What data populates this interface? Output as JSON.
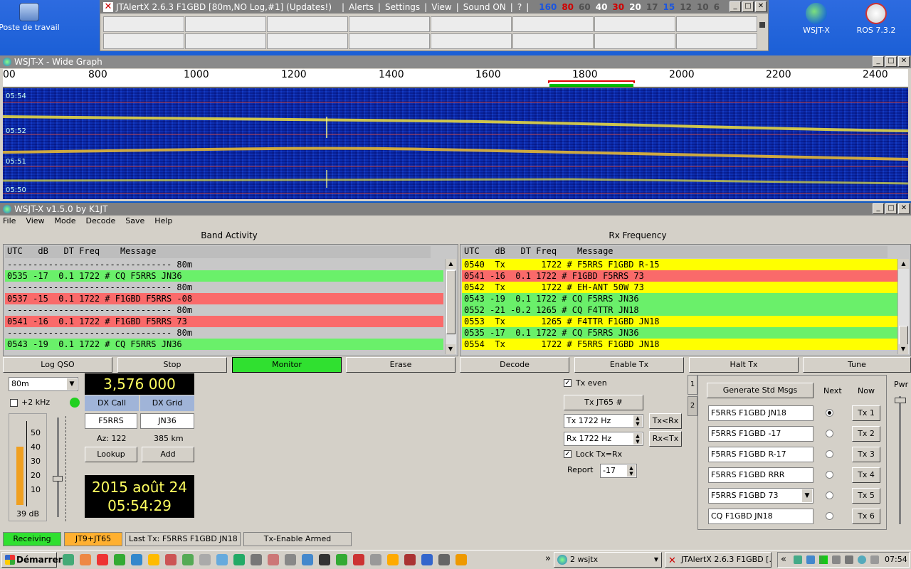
{
  "desktop": {
    "icons": [
      {
        "label": "Poste de travail"
      },
      {
        "label": "WSJT-X"
      },
      {
        "label": "ROS 7.3.2"
      }
    ]
  },
  "jtalert": {
    "title": "JTAlertX 2.6.3 F1GBD [80m,NO Log,#1] (Updates!)",
    "menu": [
      "Alerts",
      "Settings",
      "View",
      "Sound ON",
      "?"
    ],
    "bands": [
      {
        "label": "160",
        "color": "#1a55e0"
      },
      {
        "label": "80",
        "color": "#d00000"
      },
      {
        "label": "60",
        "color": "#505050"
      },
      {
        "label": "40",
        "color": "#ffffff"
      },
      {
        "label": "30",
        "color": "#d00000"
      },
      {
        "label": "20",
        "color": "#ffffff"
      },
      {
        "label": "17",
        "color": "#505050"
      },
      {
        "label": "15",
        "color": "#1a55e0"
      },
      {
        "label": "12",
        "color": "#505050"
      },
      {
        "label": "10",
        "color": "#505050"
      },
      {
        "label": "6",
        "color": "#505050"
      }
    ]
  },
  "wide_graph": {
    "title": "WSJT-X - Wide Graph",
    "scale_labels": [
      "00",
      "800",
      "1000",
      "1200",
      "1400",
      "1600",
      "1800",
      "2000",
      "2200",
      "2400"
    ],
    "time_labels": [
      "05:54",
      "05:52",
      "05:51",
      "05:50"
    ]
  },
  "main": {
    "title": "WSJT-X  v1.5.0  by K1JT",
    "menu": [
      "File",
      "View",
      "Mode",
      "Decode",
      "Save",
      "Help"
    ],
    "band_activity": {
      "header": "Band Activity",
      "columns": "UTC   dB   DT Freq    Message",
      "rows": [
        {
          "text": "-------------------------------- 80m",
          "color": "#c8c8c8"
        },
        {
          "text": "0535 -17  0.1 1722 # CQ F5RRS JN36",
          "color": "#6af06a"
        },
        {
          "text": "-------------------------------- 80m",
          "color": "#c8c8c8"
        },
        {
          "text": "0537 -15  0.1 1722 # F1GBD F5RRS -08",
          "color": "#fa6a6a"
        },
        {
          "text": "-------------------------------- 80m",
          "color": "#c8c8c8"
        },
        {
          "text": "0541 -16  0.1 1722 # F1GBD F5RRS 73",
          "color": "#fa6a6a"
        },
        {
          "text": "-------------------------------- 80m",
          "color": "#c8c8c8"
        },
        {
          "text": "0543 -19  0.1 1722 # CQ F5RRS JN36",
          "color": "#6af06a"
        }
      ]
    },
    "rx_frequency": {
      "header": "Rx Frequency",
      "columns": "UTC   dB   DT Freq    Message",
      "rows": [
        {
          "text": "0540  Tx       1722 # F5RRS F1GBD R-15",
          "color": "#ffff00"
        },
        {
          "text": "0541 -16  0.1 1722 # F1GBD F5RRS 73",
          "color": "#fa6a6a"
        },
        {
          "text": "0542  Tx       1722 # EH-ANT 50W 73",
          "color": "#ffff00"
        },
        {
          "text": "0543 -19  0.1 1722 # CQ F5RRS JN36",
          "color": "#6af06a"
        },
        {
          "text": "0552 -21 -0.2 1265 # CQ F4TTR JN18",
          "color": "#6af06a"
        },
        {
          "text": "0553  Tx       1265 # F4TTR F1GBD JN18",
          "color": "#ffff00"
        },
        {
          "text": "0535 -17  0.1 1722 # CQ F5RRS JN36",
          "color": "#6af06a"
        },
        {
          "text": "0554  Tx       1722 # F5RRS F1GBD JN18",
          "color": "#ffff00"
        }
      ]
    },
    "buttons": {
      "log_qso": "Log QSO",
      "stop": "Stop",
      "monitor": "Monitor",
      "erase": "Erase",
      "decode": "Decode",
      "enable_tx": "Enable Tx",
      "halt_tx": "Halt Tx",
      "tune": "Tune"
    },
    "band_select": "80m",
    "plus2khz": "+2 kHz",
    "frequency": "3,576 000",
    "dx_call_label": "DX Call",
    "dx_grid_label": "DX Grid",
    "dx_call": "F5RRS",
    "dx_grid": "JN36",
    "azimuth": "Az: 122",
    "distance": "385 km",
    "lookup": "Lookup",
    "add": "Add",
    "meter_labels": [
      "50",
      "40",
      "30",
      "20",
      "10"
    ],
    "meter_level": 39,
    "meter_readout": "39  dB",
    "date": "2015 août 24",
    "time": "05:54:29",
    "tx_even": "Tx even",
    "tx_mode": "Tx JT65  #",
    "tx_freq": "Tx  1722  Hz",
    "rx_freq": "Rx  1722  Hz",
    "tx_lt_rx": "Tx<Rx",
    "rx_lt_tx": "Rx<Tx",
    "lock": "Lock Tx=Rx",
    "report_label": "Report",
    "report": "-17",
    "tab1": "1",
    "tab2": "2",
    "gen_msgs": "Generate Std Msgs",
    "next_label": "Next",
    "now_label": "Now",
    "pwr_label": "Pwr",
    "messages": [
      {
        "text": "F5RRS F1GBD JN18",
        "btn": "Tx 1"
      },
      {
        "text": "F5RRS F1GBD -17",
        "btn": "Tx 2"
      },
      {
        "text": "F5RRS F1GBD R-17",
        "btn": "Tx 3"
      },
      {
        "text": "F5RRS F1GBD RRR",
        "btn": "Tx 4"
      },
      {
        "text": "F5RRS F1GBD 73",
        "btn": "Tx 5"
      },
      {
        "text": "CQ F1GBD JN18",
        "btn": "Tx 6"
      }
    ],
    "status": {
      "receiving": "Receiving",
      "mode": "JT9+JT65",
      "last_tx": "Last Tx:  F5RRS F1GBD JN18",
      "tx_enable": "Tx-Enable Armed"
    }
  },
  "taskbar": {
    "start": "Démarrer",
    "chevron": "»",
    "task_group": "2 wsjtx",
    "task_jtalert": "JTAlertX 2.6.3 F1GBD [...",
    "tray_chevron": "«",
    "clock": "07:54"
  },
  "colors": {
    "green": "#6af06a",
    "red": "#fa6a6a",
    "yellow": "#ffff00",
    "monitor": "#30e030",
    "receiving": "#30e030",
    "mode": "#ffb030"
  }
}
